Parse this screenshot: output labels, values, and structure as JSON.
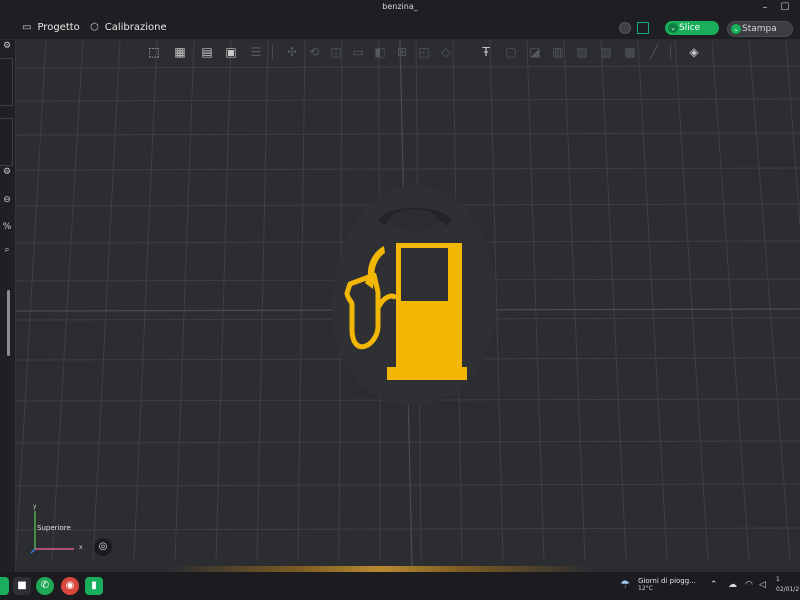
{
  "window": {
    "title": "benzina_",
    "minimize": "–",
    "maximize": "☐"
  },
  "menu": {
    "tabs": [
      {
        "label": "Progetto"
      },
      {
        "label": "Calibrazione"
      }
    ],
    "slice_label": "Slice",
    "print_label": "Stampa"
  },
  "viewport": {
    "view_label": "Superiore",
    "axis_x": "x",
    "axis_y": "y",
    "model": {
      "name": "fuel pump keychain",
      "base_color": "#2f3033",
      "icon_color": "#f2b705"
    }
  },
  "taskbar": {
    "weather_text": "Giorni di piogg...",
    "weather_temp": "12°C",
    "clock_time": "1",
    "clock_date": "02/01/2"
  },
  "colors": {
    "accent": "#19ae5c",
    "background": "#2b2d31",
    "bar": "#1e1f22"
  }
}
